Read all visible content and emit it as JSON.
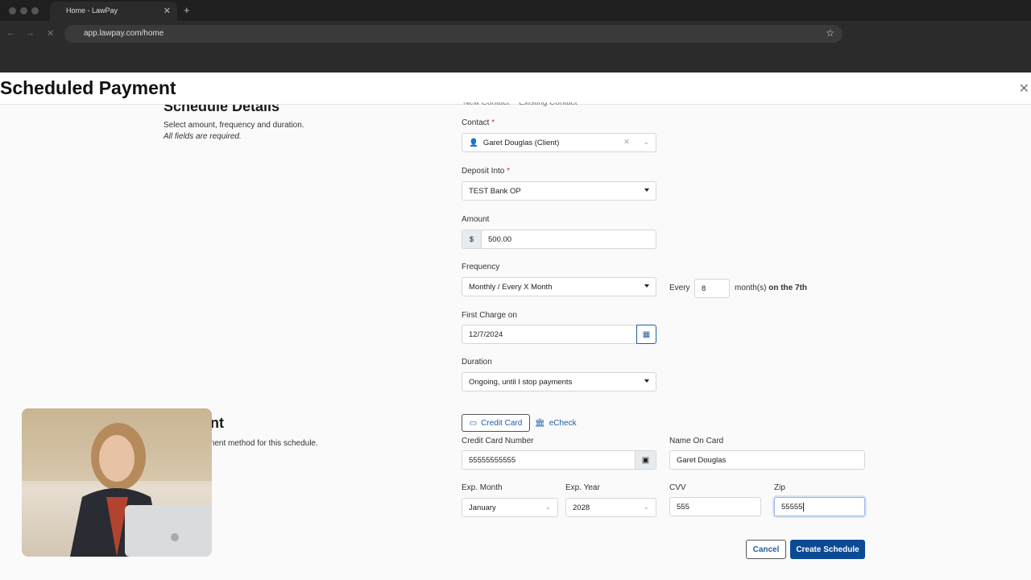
{
  "browser": {
    "tab_title": "Home - LawPay",
    "url": "app.lawpay.com/home"
  },
  "modal": {
    "title": "Scheduled Payment"
  },
  "schedule": {
    "heading": "Schedule Details",
    "subtitle": "Select amount, frequency and duration.",
    "note": "All fields are required.",
    "contact_options": [
      "New Contact",
      "Existing Contact"
    ],
    "contact_label": "Contact",
    "contact_value": "Garet Douglas (Client)",
    "deposit_label": "Deposit Into",
    "deposit_value": "TEST Bank OP",
    "amount_label": "Amount",
    "currency": "$",
    "amount_value": "500.00",
    "frequency_label": "Frequency",
    "frequency_value": "Monthly / Every X Month",
    "every_label": "Every",
    "every_value": "8",
    "months_label": "month(s)",
    "on_label": "on the 7th",
    "first_charge_label": "First Charge on",
    "first_charge_value": "12/7/2024",
    "duration_label": "Duration",
    "duration_value": "Ongoing, until I stop payments"
  },
  "payment": {
    "heading": "Payment",
    "subtitle": "Select a payment method for this schedule.",
    "tabs": [
      {
        "label": "Credit Card",
        "active": true
      },
      {
        "label": "eCheck",
        "active": false
      }
    ],
    "card_number_label": "Credit Card Number",
    "card_number_value": "55555555555",
    "name_label": "Name On Card",
    "name_value": "Garet Douglas",
    "exp_month_label": "Exp. Month",
    "exp_month_value": "January",
    "exp_year_label": "Exp. Year",
    "exp_year_value": "2028",
    "cvv_label": "CVV",
    "cvv_value": "555",
    "zip_label": "Zip",
    "zip_value": "55555"
  },
  "actions": {
    "cancel": "Cancel",
    "create": "Create Schedule"
  },
  "colors": {
    "primary": "#0b4a94",
    "link": "#1f5fa8"
  }
}
